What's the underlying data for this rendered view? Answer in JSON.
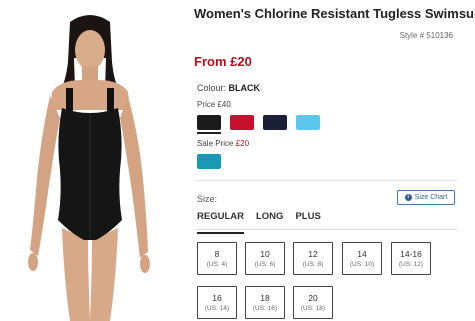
{
  "product": {
    "title": "Women's Chlorine Resistant Tugless Swimsuit",
    "style": "Style # 510136",
    "price_from": "From £20"
  },
  "colour": {
    "label": "Colour:",
    "selected": "BLACK",
    "regular_price_label": "Price £40",
    "regular_swatches": [
      {
        "name": "black",
        "color": "#1b1b1b"
      },
      {
        "name": "red",
        "color": "#c8102e"
      },
      {
        "name": "navy",
        "color": "#1a2035"
      },
      {
        "name": "light-blue",
        "color": "#5bc6ee"
      }
    ],
    "sale_label": "Sale Price",
    "sale_price": "£20",
    "sale_swatches": [
      {
        "name": "teal",
        "color": "#1a98b4"
      }
    ]
  },
  "size": {
    "label": "Size:",
    "chart_label": "Size Chart",
    "tabs": [
      {
        "label": "REGULAR",
        "active": true
      },
      {
        "label": "LONG",
        "active": false
      },
      {
        "label": "PLUS",
        "active": false
      }
    ],
    "options": [
      {
        "size": "8",
        "us": "(US: 4)"
      },
      {
        "size": "10",
        "us": "(US: 6)"
      },
      {
        "size": "12",
        "us": "(US: 8)"
      },
      {
        "size": "14",
        "us": "(US: 10)"
      },
      {
        "size": "14-16",
        "us": "(US: 12)"
      },
      {
        "size": "16",
        "us": "(US: 14)"
      },
      {
        "size": "18",
        "us": "(US: 16)"
      },
      {
        "size": "20",
        "us": "(US: 18)"
      }
    ]
  },
  "icons": {
    "info": "info-icon"
  }
}
